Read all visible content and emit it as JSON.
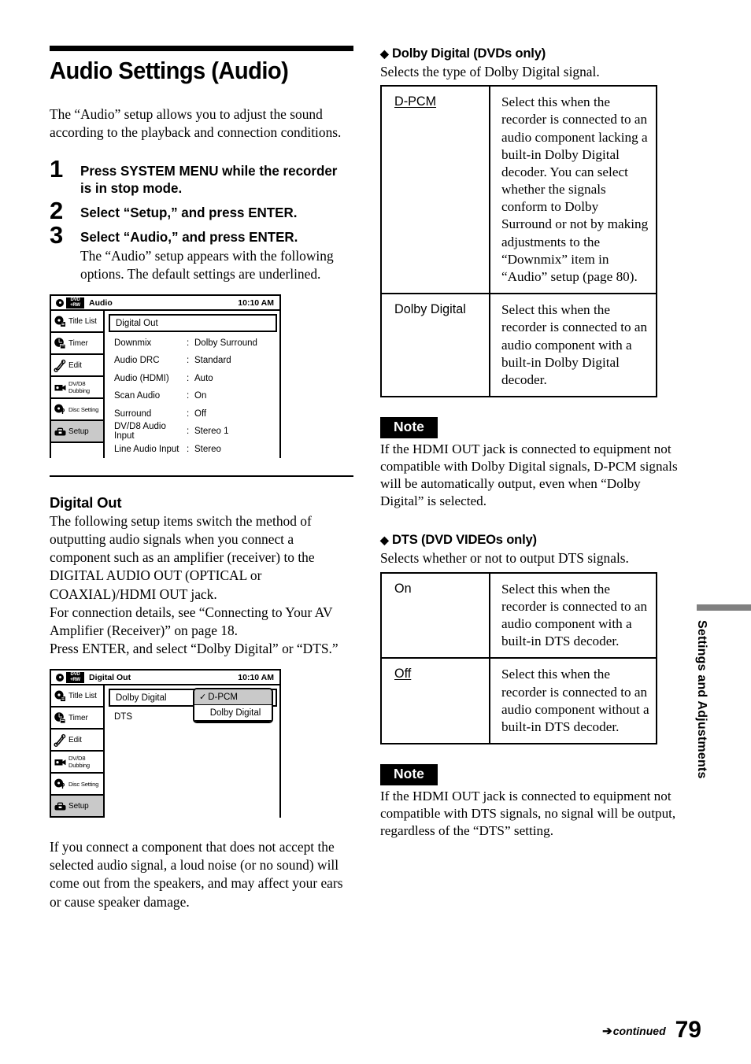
{
  "page": {
    "number": "79",
    "continued_label": "continued",
    "side_tab_label": "Settings and Adjustments"
  },
  "left": {
    "title": "Audio Settings (Audio)",
    "intro": "The “Audio” setup allows you to adjust the sound according to the playback and connection conditions.",
    "steps": [
      {
        "num": "1",
        "head": "Press SYSTEM MENU while the recorder is in stop mode.",
        "sub": ""
      },
      {
        "num": "2",
        "head": "Select “Setup,” and press ENTER.",
        "sub": ""
      },
      {
        "num": "3",
        "head": "Select “Audio,” and press ENTER.",
        "sub": "The “Audio” setup appears with the following options. The default settings are underlined."
      }
    ],
    "digital_out": {
      "heading": "Digital Out",
      "paragraphs": [
        "The following setup items switch the method of outputting audio signals when you connect a component such as an amplifier (receiver) to the DIGITAL AUDIO OUT (OPTICAL or COAXIAL)/HDMI OUT jack.",
        "For connection details, see “Connecting to Your AV Amplifier (Receiver)” on page 18.",
        "Press ENTER, and select “Dolby Digital” or “DTS.”"
      ],
      "warning": "If you connect a component that does not accept the selected audio signal, a loud noise (or no sound) will come out from the speakers, and may affect your ears or cause speaker damage."
    }
  },
  "mock_audio": {
    "disc_badge_line1": "DVD",
    "disc_badge_line2": "+RW",
    "title": "Audio",
    "time": "10:10 AM",
    "sidebar": [
      {
        "label": "Title List",
        "icon": "title-list-icon",
        "active": false
      },
      {
        "label": "Timer",
        "icon": "timer-icon",
        "active": false
      },
      {
        "label": "Edit",
        "icon": "scissors-icon",
        "active": false
      },
      {
        "label": "DV/D8 Dubbing",
        "icon": "camcorder-icon",
        "active": false
      },
      {
        "label": "Disc Setting",
        "icon": "disc-setting-icon",
        "active": false
      },
      {
        "label": "Setup",
        "icon": "toolbox-icon",
        "active": true
      }
    ],
    "selected_row": "Digital Out",
    "rows": [
      {
        "key": "Downmix",
        "sep": ":",
        "value": "Dolby Surround"
      },
      {
        "key": "Audio DRC",
        "sep": ":",
        "value": "Standard"
      },
      {
        "key": "Audio (HDMI)",
        "sep": ":",
        "value": "Auto"
      },
      {
        "key": "Scan Audio",
        "sep": ":",
        "value": "On"
      },
      {
        "key": "Surround",
        "sep": ":",
        "value": "Off"
      },
      {
        "key": "DV/D8 Audio Input",
        "sep": ":",
        "value": "Stereo 1"
      },
      {
        "key": "Line Audio Input",
        "sep": ":",
        "value": "Stereo"
      }
    ]
  },
  "mock_digital_out": {
    "disc_badge_line1": "DVD",
    "disc_badge_line2": "+RW",
    "title": "Digital Out",
    "time": "10:10 AM",
    "sidebar": [
      {
        "label": "Title List",
        "icon": "title-list-icon",
        "active": false
      },
      {
        "label": "Timer",
        "icon": "timer-icon",
        "active": false
      },
      {
        "label": "Edit",
        "icon": "scissors-icon",
        "active": false
      },
      {
        "label": "DV/D8 Dubbing",
        "icon": "camcorder-icon",
        "active": false
      },
      {
        "label": "Disc Setting",
        "icon": "disc-setting-icon",
        "active": false
      },
      {
        "label": "Setup",
        "icon": "toolbox-icon",
        "active": true
      }
    ],
    "selected_row": "Dolby Digital",
    "rows": [
      {
        "key": "DTS",
        "sep": "",
        "value": ""
      }
    ],
    "popup": {
      "check_glyph": "✓",
      "items": [
        {
          "label": "D-PCM",
          "selected": true
        },
        {
          "label": "Dolby Digital",
          "selected": false
        }
      ]
    }
  },
  "right": {
    "dolby": {
      "heading": "Dolby Digital (DVDs only)",
      "diamond": "◆",
      "intro": "Selects the type of Dolby Digital signal.",
      "rows": [
        {
          "key": "D-PCM",
          "key_underlined": true,
          "desc": "Select this when the recorder is connected to an audio component lacking a built-in Dolby Digital decoder. You can select whether the signals conform to Dolby Surround or not by making adjustments to the “Downmix” item in “Audio” setup (page 80)."
        },
        {
          "key": "Dolby Digital",
          "key_underlined": false,
          "desc": "Select this when the recorder is connected to an audio component with a built-in Dolby Digital decoder."
        }
      ],
      "note_label": "Note",
      "note_text": "If the HDMI OUT jack is connected to equipment not compatible with Dolby Digital signals, D-PCM signals will be automatically output, even when “Dolby Digital” is selected."
    },
    "dts": {
      "heading": "DTS (DVD VIDEOs only)",
      "diamond": "◆",
      "intro": "Selects whether or not to output DTS signals.",
      "rows": [
        {
          "key": "On",
          "key_underlined": false,
          "desc": "Select this when the recorder is connected to an audio component with a built-in DTS decoder."
        },
        {
          "key": "Off",
          "key_underlined": true,
          "desc": "Select this when the recorder is connected to an audio component without a built-in DTS decoder."
        }
      ],
      "note_label": "Note",
      "note_text": "If the HDMI OUT jack is connected to equipment not compatible with DTS signals, no signal will be output, regardless of the “DTS” setting."
    }
  }
}
